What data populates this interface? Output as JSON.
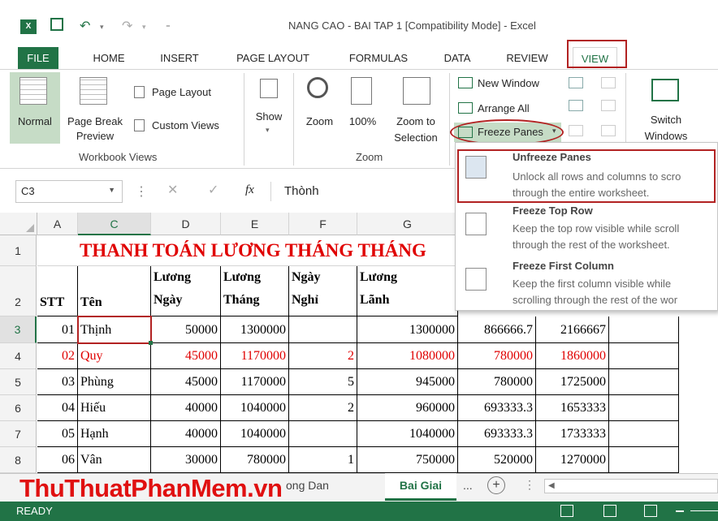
{
  "title_bar": {
    "app_icon": "excel-icon",
    "title": "NANG CAO - BAI TAP 1  [Compatibility Mode] - Excel",
    "undo_glyph": "↶",
    "redo_glyph": "↷"
  },
  "tabs": [
    "FILE",
    "HOME",
    "INSERT",
    "PAGE LAYOUT",
    "FORMULAS",
    "DATA",
    "REVIEW",
    "VIEW"
  ],
  "ribbon": {
    "workbook_views": {
      "normal": "Normal",
      "page_break_preview_1": "Page Break",
      "page_break_preview_2": "Preview",
      "page_layout": "Page Layout",
      "custom_views": "Custom Views",
      "group_title": "Workbook Views"
    },
    "show": "Show",
    "zoom": {
      "zoom": "Zoom",
      "hundred": "100%",
      "zoom_to_selection_1": "Zoom to",
      "zoom_to_selection_2": "Selection",
      "group_title": "Zoom"
    },
    "window": {
      "new_window": "New Window",
      "arrange_all": "Arrange All",
      "freeze_panes": "Freeze Panes",
      "switch_windows_1": "Switch",
      "switch_windows_2": "Windows"
    }
  },
  "formula_bar": {
    "name_box": "C3",
    "fx": "fx",
    "value": "Thònh"
  },
  "columns": [
    "A",
    "C",
    "D",
    "E",
    "F",
    "G"
  ],
  "rows": [
    "1",
    "2",
    "3",
    "4",
    "5",
    "6",
    "7",
    "8"
  ],
  "sheet": {
    "title": "THANH TOÁN LƯƠNG THÁNG THÁNG",
    "headers": {
      "stt": "STT",
      "ten": "Tên",
      "luong_ngay_1": "Lương",
      "luong_ngay_2": "Ngày",
      "luong_thang_1": "Lương",
      "luong_thang_2": "Tháng",
      "ngay_nghi_1": "Ngày",
      "ngay_nghi_2": "Nghỉ",
      "luong_lanh_1": "Lương",
      "luong_lanh_2": "Lãnh"
    },
    "data": [
      {
        "stt": "01",
        "ten": "Thịnh",
        "d": "50000",
        "e": "1300000",
        "f": "",
        "g": "1300000",
        "h": "866666.7",
        "i": "2166667"
      },
      {
        "stt": "02",
        "ten": "Quy",
        "d": "45000",
        "e": "1170000",
        "f": "2",
        "g": "1080000",
        "h": "780000",
        "i": "1860000"
      },
      {
        "stt": "03",
        "ten": "Phùng",
        "d": "45000",
        "e": "1170000",
        "f": "5",
        "g": "945000",
        "h": "780000",
        "i": "1725000"
      },
      {
        "stt": "04",
        "ten": "Hiếu",
        "d": "40000",
        "e": "1040000",
        "f": "2",
        "g": "960000",
        "h": "693333.3",
        "i": "1653333"
      },
      {
        "stt": "05",
        "ten": "Hạnh",
        "d": "40000",
        "e": "1040000",
        "f": "",
        "g": "1040000",
        "h": "693333.3",
        "i": "1733333"
      },
      {
        "stt": "06",
        "ten": "Vân",
        "d": "30000",
        "e": "780000",
        "f": "1",
        "g": "750000",
        "h": "520000",
        "i": "1270000"
      }
    ]
  },
  "freeze_menu": {
    "unfreeze_title": "Unfreeze Panes",
    "unfreeze_desc_1": "Unlock all rows and columns to scro",
    "unfreeze_desc_2": "through the entire worksheet.",
    "top_row_title": "Freeze Top Row",
    "top_row_desc_1": "Keep the top row visible while scroll",
    "top_row_desc_2": "through the rest of the worksheet.",
    "first_col_title": "Freeze First Column",
    "first_col_desc_1": "Keep the first column visible while",
    "first_col_desc_2": "scrolling through the rest of the wor"
  },
  "sheet_tabs": {
    "partial": "ong Dan",
    "active": "Bai Giai",
    "more": "...",
    "add": "+"
  },
  "watermark": "ThuThuatPhanMem.vn",
  "status": {
    "ready": "READY"
  },
  "colors": {
    "excel_green": "#217346",
    "highlight_red": "#b22222",
    "title_red": "#e00000"
  }
}
